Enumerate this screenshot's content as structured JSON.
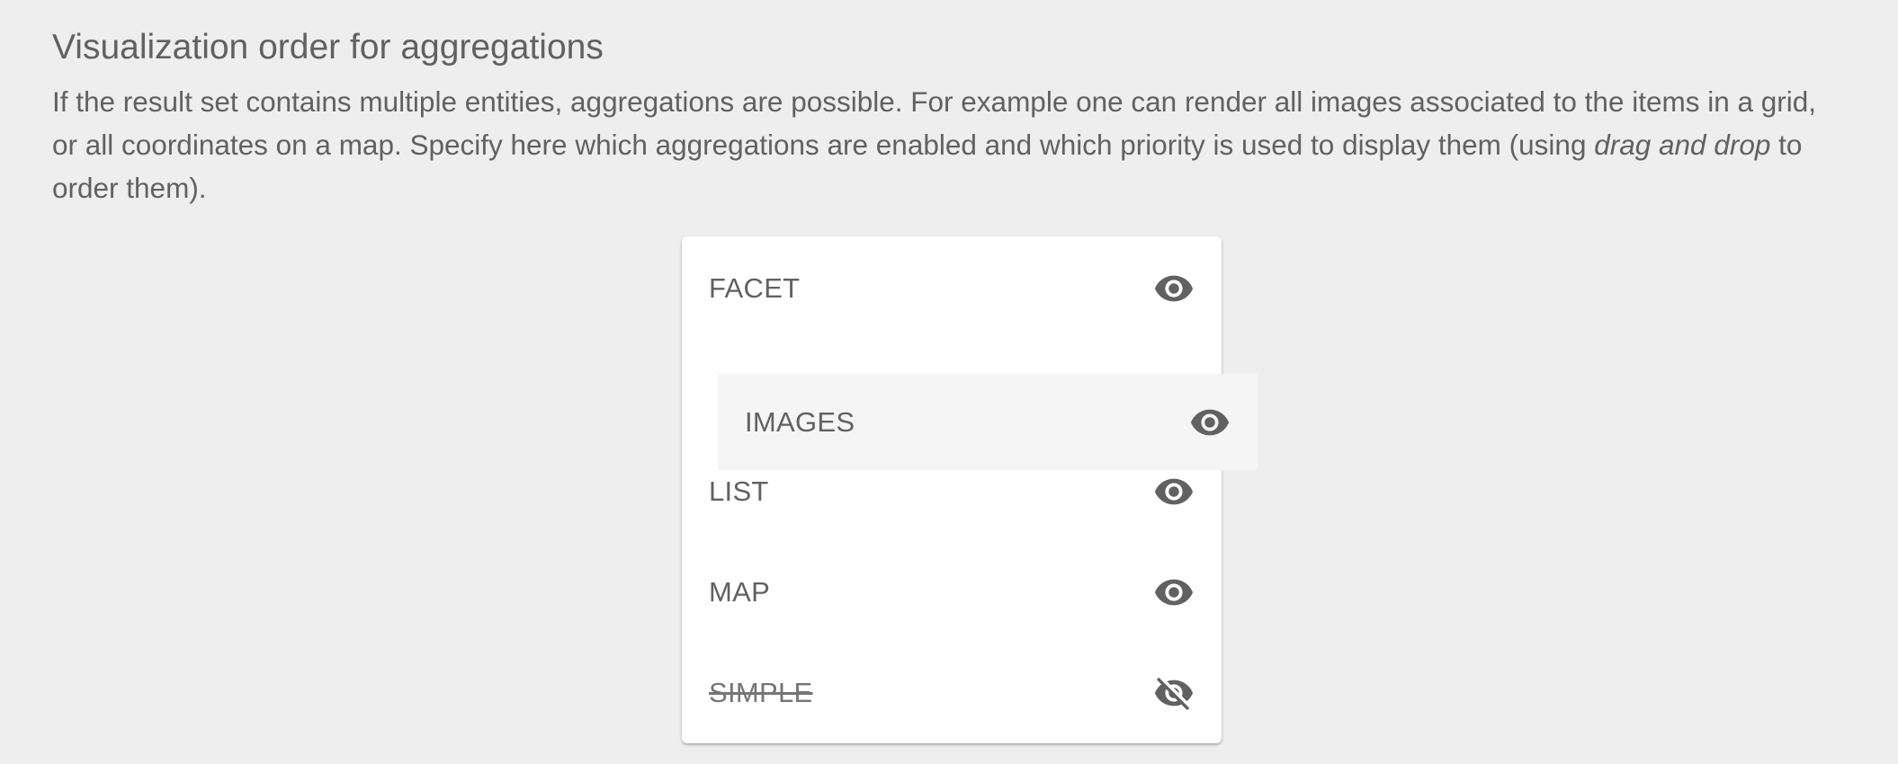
{
  "section": {
    "title": "Visualization order for aggregations",
    "description_part1": "If the result set contains multiple entities, aggregations are possible. For example one can render all images associated to the items in a grid, or all coordinates on a map. Specify here which aggregations are enabled and which priority is used to display them (using ",
    "description_emphasis": "drag and drop",
    "description_part2": " to order them)."
  },
  "aggregations": {
    "items": [
      {
        "label": "FACET",
        "visible": true,
        "icon": "eye-icon"
      },
      {
        "label": "LIST",
        "visible": true,
        "icon": "eye-icon"
      },
      {
        "label": "MAP",
        "visible": true,
        "icon": "eye-icon"
      },
      {
        "label": "SIMPLE",
        "visible": false,
        "icon": "eye-off-icon"
      }
    ],
    "dragging": {
      "label": "IMAGES",
      "visible": true,
      "icon": "eye-icon"
    }
  }
}
